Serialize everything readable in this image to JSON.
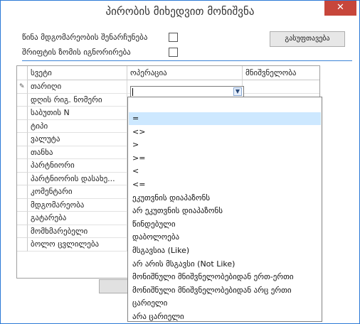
{
  "window": {
    "title": "პირობის მიხედვით მონიშვნა",
    "close_glyph": "✕"
  },
  "options": {
    "keep_previous_state_label": "წინა მდგომარეობის შენარჩუნება",
    "ignore_font_size_label": "შრიფტის ზომის იგნორირება",
    "keep_previous_state_checked": false,
    "ignore_font_size_checked": false
  },
  "refresh_button_label": "გასუფთავება",
  "grid": {
    "columns": [
      "სვეტი",
      "ოპერაცია",
      "მნიშვნელობა"
    ],
    "rows": [
      {
        "column": "თარიღი",
        "operation": "",
        "value": ""
      },
      {
        "column": "დღის რიგ. ნომერი",
        "operation": "",
        "value": ""
      },
      {
        "column": "საბუთის N",
        "operation": "",
        "value": ""
      },
      {
        "column": "ტიპი",
        "operation": "",
        "value": ""
      },
      {
        "column": "ვალუტა",
        "operation": "",
        "value": ""
      },
      {
        "column": "თანხა",
        "operation": "",
        "value": ""
      },
      {
        "column": "პარტნიორი",
        "operation": "",
        "value": ""
      },
      {
        "column": "პარტნიორის დასახე...",
        "operation": "",
        "value": ""
      },
      {
        "column": "კომენტარი",
        "operation": "",
        "value": ""
      },
      {
        "column": "მდგომარეობა",
        "operation": "",
        "value": ""
      },
      {
        "column": "გატარება",
        "operation": "",
        "value": ""
      },
      {
        "column": "მომხმარებელი",
        "operation": "",
        "value": ""
      },
      {
        "column": "ბოლო ცვლილება",
        "operation": "",
        "value": ""
      }
    ]
  },
  "operation_dropdown": {
    "selected": "=",
    "items": [
      "=",
      "<>",
      ">",
      ">=",
      "<",
      "<=",
      "ეკუთვნის დიაპაზონს",
      "არ ეკუთვნის დიაპაზონს",
      "წინდებული",
      "დაბოლოება",
      "მსგავსია (Like)",
      "არ არის მსგავსი (Not Like)",
      "მონიშნული მნიშვნელობებიდან ერთ-ერთი",
      "მონიშნული მნიშვნელობებიდან არც ერთი",
      "ცარიელი",
      "არა ცარიელი"
    ]
  },
  "icons": {
    "edit_row_indicator": "pencil-icon",
    "dropdown_arrow": "chevron-down-icon"
  },
  "colors": {
    "window_border": "#2b79d6",
    "close_button": "#c7463b",
    "separator": "#3d84d6",
    "dropdown_selection": "#cde8ff"
  }
}
